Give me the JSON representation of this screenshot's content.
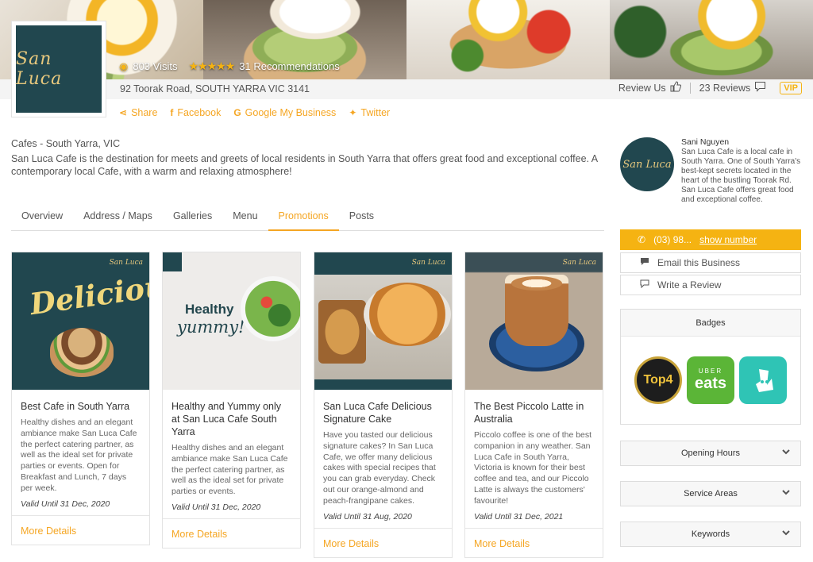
{
  "hero": {
    "visits": "803 Visits",
    "recommendations": "31 Recommendations",
    "stars": "★★★★★"
  },
  "business": {
    "logo_text": "San Luca",
    "address": "92 Toorak Road, SOUTH YARRA VIC 3141",
    "category": "Cafes - South Yarra, VIC",
    "description": "San Luca Cafe is the destination for meets and greets of local residents in South Yarra that offers great food and exceptional coffee. A contemporary local Cafe, with a warm and relaxing atmosphere!"
  },
  "review_bar": {
    "review_us": "Review Us",
    "reviews": "23 Reviews",
    "vip": "VIP"
  },
  "social": {
    "share": "Share",
    "facebook": "Facebook",
    "google": "Google My Business",
    "twitter": "Twitter"
  },
  "tabs": [
    "Overview",
    "Address / Maps",
    "Galleries",
    "Menu",
    "Promotions",
    "Posts"
  ],
  "active_tab": "Promotions",
  "cards": [
    {
      "title": "Best Cafe in South Yarra",
      "text": "Healthy dishes and an elegant ambiance make San Luca Cafe the perfect catering partner, as well as the ideal set for private parties or events. Open for Breakfast and Lunch, 7 days per week.",
      "valid": "Valid Until 31 Dec, 2020",
      "more": "More Details",
      "image_text": "Delicious"
    },
    {
      "title": "Healthy and Yummy only at San Luca Cafe South Yarra",
      "text": "Healthy dishes and an elegant ambiance make San Luca Cafe the perfect catering partner, as well as the ideal set for private parties or events.",
      "valid": "Valid Until 31 Dec, 2020",
      "more": "More Details",
      "image_text": "Healthy",
      "image_text2": "yummy!"
    },
    {
      "title": "San Luca Cafe Delicious Signature Cake",
      "text": "Have you tasted our delicious signature cakes? In San Luca Cafe, we offer many delicious cakes with special recipes that you can grab everyday. Check out our orange-almond and peach-frangipane cakes.",
      "valid": "Valid Until 31 Aug, 2020",
      "more": "More Details"
    },
    {
      "title": "The Best Piccolo Latte in Australia",
      "text": "Piccolo coffee is one of the best companion in any weather. San Luca Cafe in South Yarra, Victoria is known for their best coffee and tea, and our Piccolo Latte is always the customers' favourite!",
      "valid": "Valid Until 31 Dec, 2021",
      "more": "More Details"
    }
  ],
  "author": {
    "name": "Sani Nguyen",
    "bio": "San Luca Cafe is a local cafe in South Yarra. One of South Yarra's best-kept secrets located in the heart of the bustling Toorak Rd. San Luca Cafe offers great food and exceptional coffee."
  },
  "sidebar": {
    "phone": "(03) 98...",
    "show_number": "show number",
    "email": "Email this Business",
    "review": "Write a Review",
    "badges_title": "Badges",
    "badge_top4": "Top4",
    "badge_uber_small": "UBER",
    "badge_uber_big": "eats",
    "accordions": [
      "Opening Hours",
      "Service Areas",
      "Keywords"
    ]
  },
  "colors": {
    "accent": "#f5a623",
    "brand_teal": "#21474f"
  }
}
